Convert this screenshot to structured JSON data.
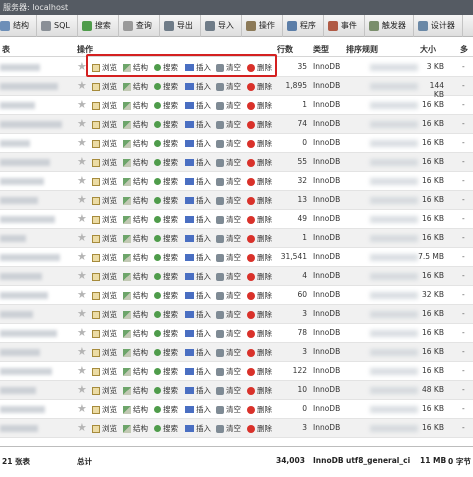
{
  "window": {
    "title": "服务器: localhost"
  },
  "toolbar": [
    {
      "label": "结构",
      "icon": "structure-icon",
      "color": "#6d8fb8"
    },
    {
      "label": "SQL",
      "icon": "sql-icon",
      "color": "#8a8f96"
    },
    {
      "label": "搜索",
      "icon": "search-icon",
      "color": "#4f9c4b"
    },
    {
      "label": "查询",
      "icon": "query-icon",
      "color": "#9a9a9a"
    },
    {
      "label": "导出",
      "icon": "export-icon",
      "color": "#6f7c88"
    },
    {
      "label": "导入",
      "icon": "import-icon",
      "color": "#6f7c88"
    },
    {
      "label": "操作",
      "icon": "wrench-icon",
      "color": "#8c7a58"
    },
    {
      "label": "程序",
      "icon": "routines-icon",
      "color": "#5c7ea8"
    },
    {
      "label": "事件",
      "icon": "clock-icon",
      "color": "#b05a45"
    },
    {
      "label": "触发器",
      "icon": "trigger-icon",
      "color": "#7a8e6c"
    },
    {
      "label": "设计器",
      "icon": "designer-icon",
      "color": "#6a88a6"
    }
  ],
  "table_header": {
    "table": "表",
    "actions": "操作",
    "rows": "行数",
    "type": "类型",
    "collation": "排序规则",
    "size": "大小",
    "overhead": "多"
  },
  "actions": {
    "browse": "浏览",
    "structure": "结构",
    "search": "搜索",
    "insert": "插入",
    "empty": "清空",
    "drop": "删除"
  },
  "rows": [
    {
      "count": "35",
      "engine": "InnoDB",
      "size": "3 KB",
      "overhead": "-"
    },
    {
      "count": "1,895",
      "engine": "InnoDB",
      "size": "144 KB",
      "overhead": "-"
    },
    {
      "count": "1",
      "engine": "InnoDB",
      "size": "16 KB",
      "overhead": "-"
    },
    {
      "count": "74",
      "engine": "InnoDB",
      "size": "16 KB",
      "overhead": "-"
    },
    {
      "count": "0",
      "engine": "InnoDB",
      "size": "16 KB",
      "overhead": "-"
    },
    {
      "count": "55",
      "engine": "InnoDB",
      "size": "16 KB",
      "overhead": "-"
    },
    {
      "count": "32",
      "engine": "InnoDB",
      "size": "16 KB",
      "overhead": "-"
    },
    {
      "count": "13",
      "engine": "InnoDB",
      "size": "16 KB",
      "overhead": "-"
    },
    {
      "count": "49",
      "engine": "InnoDB",
      "size": "16 KB",
      "overhead": "-"
    },
    {
      "count": "1",
      "engine": "InnoDB",
      "size": "16 KB",
      "overhead": "-"
    },
    {
      "count": "31,541",
      "engine": "InnoDB",
      "size": "7.5 MB",
      "overhead": "-"
    },
    {
      "count": "4",
      "engine": "InnoDB",
      "size": "16 KB",
      "overhead": "-"
    },
    {
      "count": "60",
      "engine": "InnoDB",
      "size": "32 KB",
      "overhead": "-"
    },
    {
      "count": "3",
      "engine": "InnoDB",
      "size": "16 KB",
      "overhead": "-"
    },
    {
      "count": "78",
      "engine": "InnoDB",
      "size": "16 KB",
      "overhead": "-"
    },
    {
      "count": "3",
      "engine": "InnoDB",
      "size": "16 KB",
      "overhead": "-"
    },
    {
      "count": "122",
      "engine": "InnoDB",
      "size": "16 KB",
      "overhead": "-"
    },
    {
      "count": "10",
      "engine": "InnoDB",
      "size": "48 KB",
      "overhead": "-"
    },
    {
      "count": "0",
      "engine": "InnoDB",
      "size": "16 KB",
      "overhead": "-"
    },
    {
      "count": "3",
      "engine": "InnoDB",
      "size": "16 KB",
      "overhead": "-"
    }
  ],
  "footer": {
    "tables": "21 张表",
    "total_label": "总计",
    "total_rows": "34,003",
    "engine": "InnoDB",
    "collation": "utf8_general_ci",
    "size": "11 MB",
    "overhead": "0 字节"
  },
  "accent": {
    "highlight": "#d42020",
    "row_alt": "#f1f1f1"
  }
}
